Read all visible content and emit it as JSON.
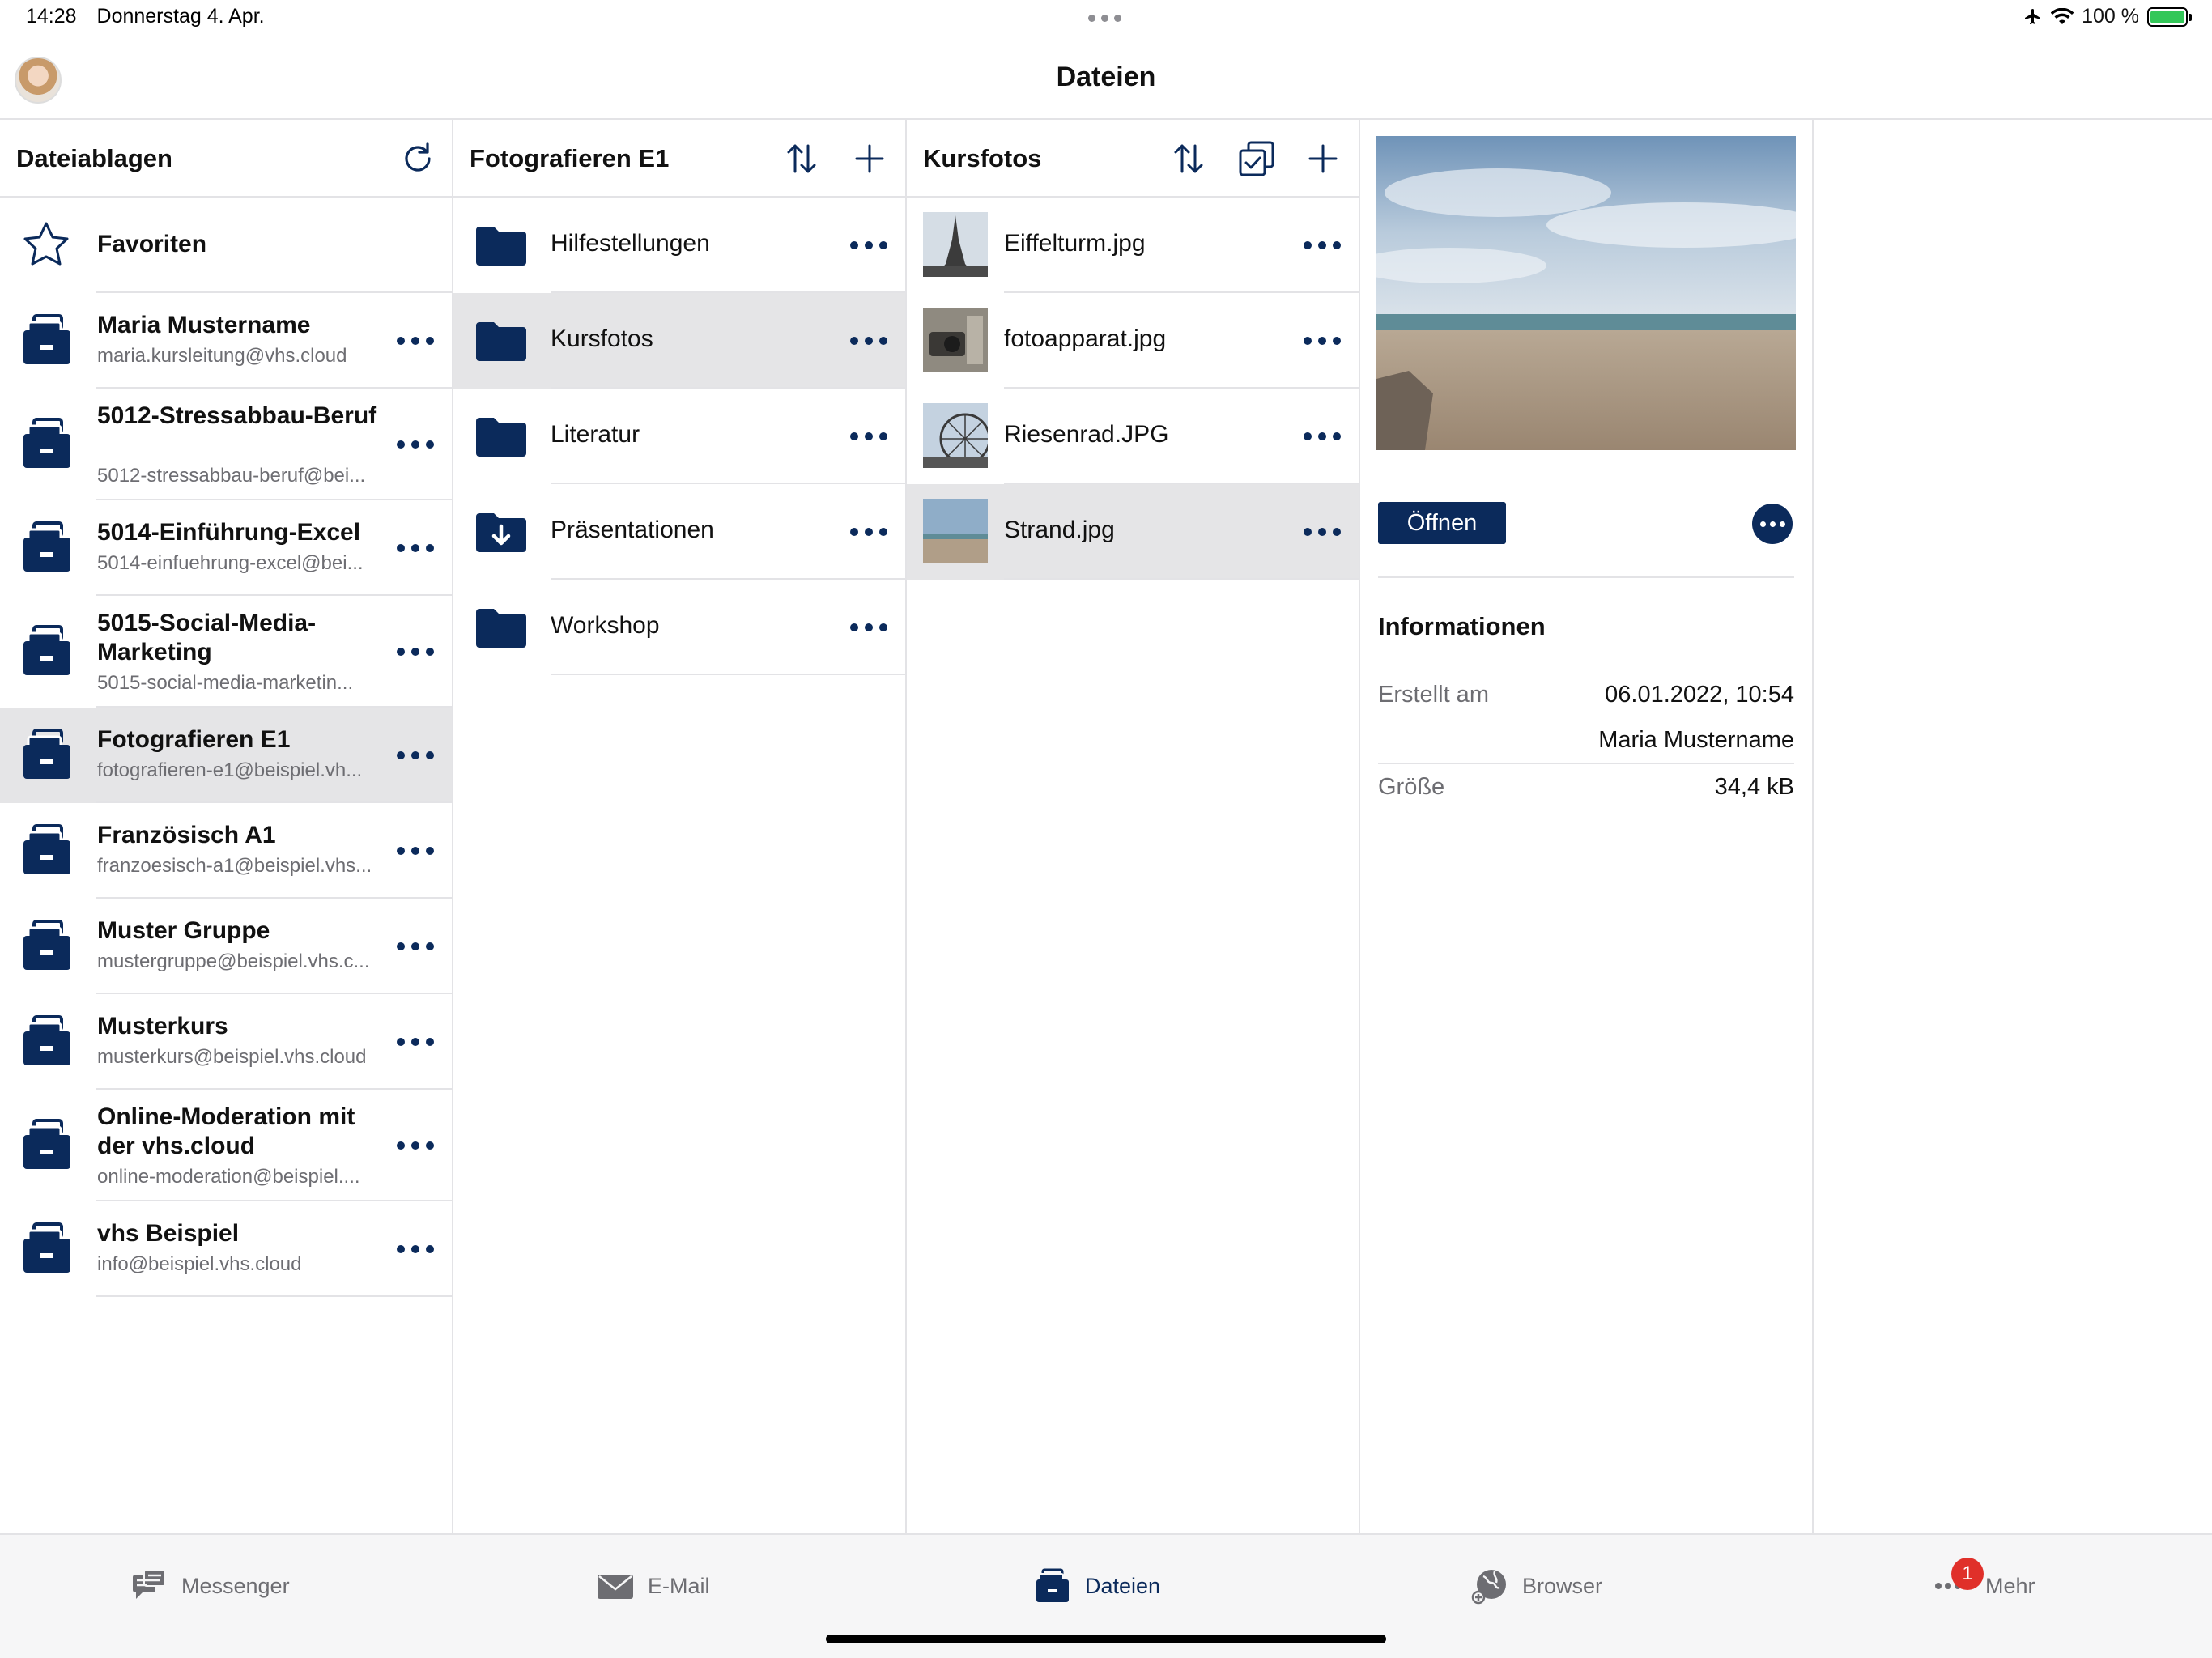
{
  "status": {
    "time": "14:28",
    "date": "Donnerstag 4. Apr.",
    "battery": "100 %"
  },
  "header": {
    "title": "Dateien"
  },
  "col1": {
    "title": "Dateiablagen",
    "favorites": "Favoriten",
    "items": [
      {
        "name": "Maria Mustername",
        "sub": "maria.kursleitung@vhs.cloud"
      },
      {
        "name": "5012-Stressabbau-Beruf",
        "sub": "5012-stressabbau-beruf@bei..."
      },
      {
        "name": "5014-Einführung-Excel",
        "sub": "5014-einfuehrung-excel@bei..."
      },
      {
        "name": "5015-Social-Media-Marketing",
        "sub": "5015-social-media-marketin..."
      },
      {
        "name": "Fotografieren E1",
        "sub": "fotografieren-e1@beispiel.vh..."
      },
      {
        "name": "Französisch A1",
        "sub": "franzoesisch-a1@beispiel.vhs..."
      },
      {
        "name": "Muster Gruppe",
        "sub": "mustergruppe@beispiel.vhs.c..."
      },
      {
        "name": "Musterkurs",
        "sub": "musterkurs@beispiel.vhs.cloud"
      },
      {
        "name": "Online-Moderation mit der vhs.cloud",
        "sub": "online-moderation@beispiel...."
      },
      {
        "name": "vhs Beispiel",
        "sub": "info@beispiel.vhs.cloud"
      }
    ]
  },
  "col2": {
    "title": "Fotografieren E1",
    "items": [
      "Hilfestellungen",
      "Kursfotos",
      "Literatur",
      "Präsentationen",
      "Workshop"
    ]
  },
  "col3": {
    "title": "Kursfotos",
    "items": [
      "Eiffelturm.jpg",
      "fotoapparat.jpg",
      "Riesenrad.JPG",
      "Strand.jpg"
    ]
  },
  "detail": {
    "open_label": "Öffnen",
    "info_title": "Informationen",
    "created_label": "Erstellt am",
    "created_value": "06.01.2022, 10:54",
    "creator": "Maria Mustername",
    "size_label": "Größe",
    "size_value": "34,4 kB"
  },
  "tabs": {
    "messenger": "Messenger",
    "email": "E-Mail",
    "files": "Dateien",
    "browser": "Browser",
    "more": "Mehr",
    "more_badge": "1"
  },
  "colors": {
    "accent": "#0b2a5b",
    "selected_row": "#e5e5e7",
    "badge": "#e0302a"
  }
}
